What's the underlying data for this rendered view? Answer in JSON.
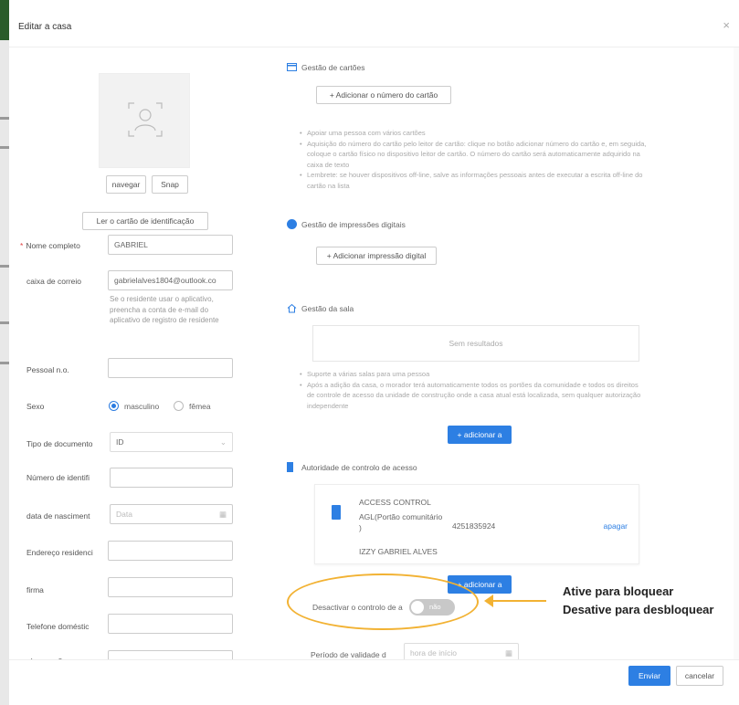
{
  "dialog": {
    "title": "Editar a casa",
    "close": "×"
  },
  "photo": {
    "browse": "navegar",
    "snap": "Snap",
    "read_id": "Ler o cartão de identificação"
  },
  "form": {
    "full_name": {
      "label": "Nome completo",
      "value": "GABRIEL"
    },
    "mailbox": {
      "label": "caixa de correio",
      "value": "gabrielalves1804@outlook.co"
    },
    "hint": "Se o residente usar o aplicativo, preencha a conta de e-mail do aplicativo de registro de residente",
    "personal_no": {
      "label": "Pessoal n.o."
    },
    "sex": {
      "label": "Sexo",
      "male": "masculino",
      "female": "fêmea"
    },
    "doc_type": {
      "label": "Tipo de documento",
      "value": "ID"
    },
    "id_number": {
      "label": "Número de identifi"
    },
    "birth_date": {
      "label": "data de nasciment",
      "placeholder": "Data"
    },
    "address": {
      "label": "Endereço residenci"
    },
    "company": {
      "label": "firma"
    },
    "home_phone": {
      "label": "Telefone doméstic"
    },
    "notes": {
      "label": "observações"
    }
  },
  "card_mgmt": {
    "title": "Gestão de cartões",
    "add": "+ Adicionar o número do cartão",
    "bullets": [
      "Apoiar uma pessoa com vários cartões",
      "Aquisição do número do cartão pelo leitor de cartão: clique no botão adicionar número do cartão e, em seguida, coloque o cartão físico no dispositivo leitor de cartão. O número do cartão será automaticamente adquirido na caixa de texto",
      "Lembrete: se houver dispositivos off-line, salve as informações pessoais antes de executar a escrita off-line do cartão na lista"
    ]
  },
  "fingerprint": {
    "title": "Gestão de impressões digitais",
    "add": "+ Adicionar impressão digital"
  },
  "room": {
    "title": "Gestão da sala",
    "empty": "Sem resultados",
    "bullets": [
      "Suporte a várias salas para uma pessoa",
      "Após a adição da casa, o morador terá automaticamente todos os portões da comunidade e todos os direitos de controle de acesso da unidade de construção onde a casa atual está localizada, sem qualquer autorização independente"
    ],
    "add": "+ adicionar a"
  },
  "access": {
    "title": "Autoridade de controlo de acesso",
    "card": {
      "name": "ACCESS CONTROL",
      "gate": "AGL(Portão comunitário",
      "paren": ")",
      "number": "4251835924",
      "person": "IZZY GABRIEL ALVES",
      "delete": "apagar"
    },
    "add": "+ adicionar a",
    "disable_label": "Desactivar o controlo de a",
    "toggle_text": "não",
    "validity_label": "Período de validade d",
    "validity_placeholder": "hora de início"
  },
  "annotation": {
    "line1": "Ative para bloquear",
    "line2": "Desative para desbloquear"
  },
  "footer": {
    "submit": "Enviar",
    "cancel": "cancelar"
  },
  "colors": {
    "primary": "#2d7fe3",
    "highlight": "#f2b233"
  }
}
